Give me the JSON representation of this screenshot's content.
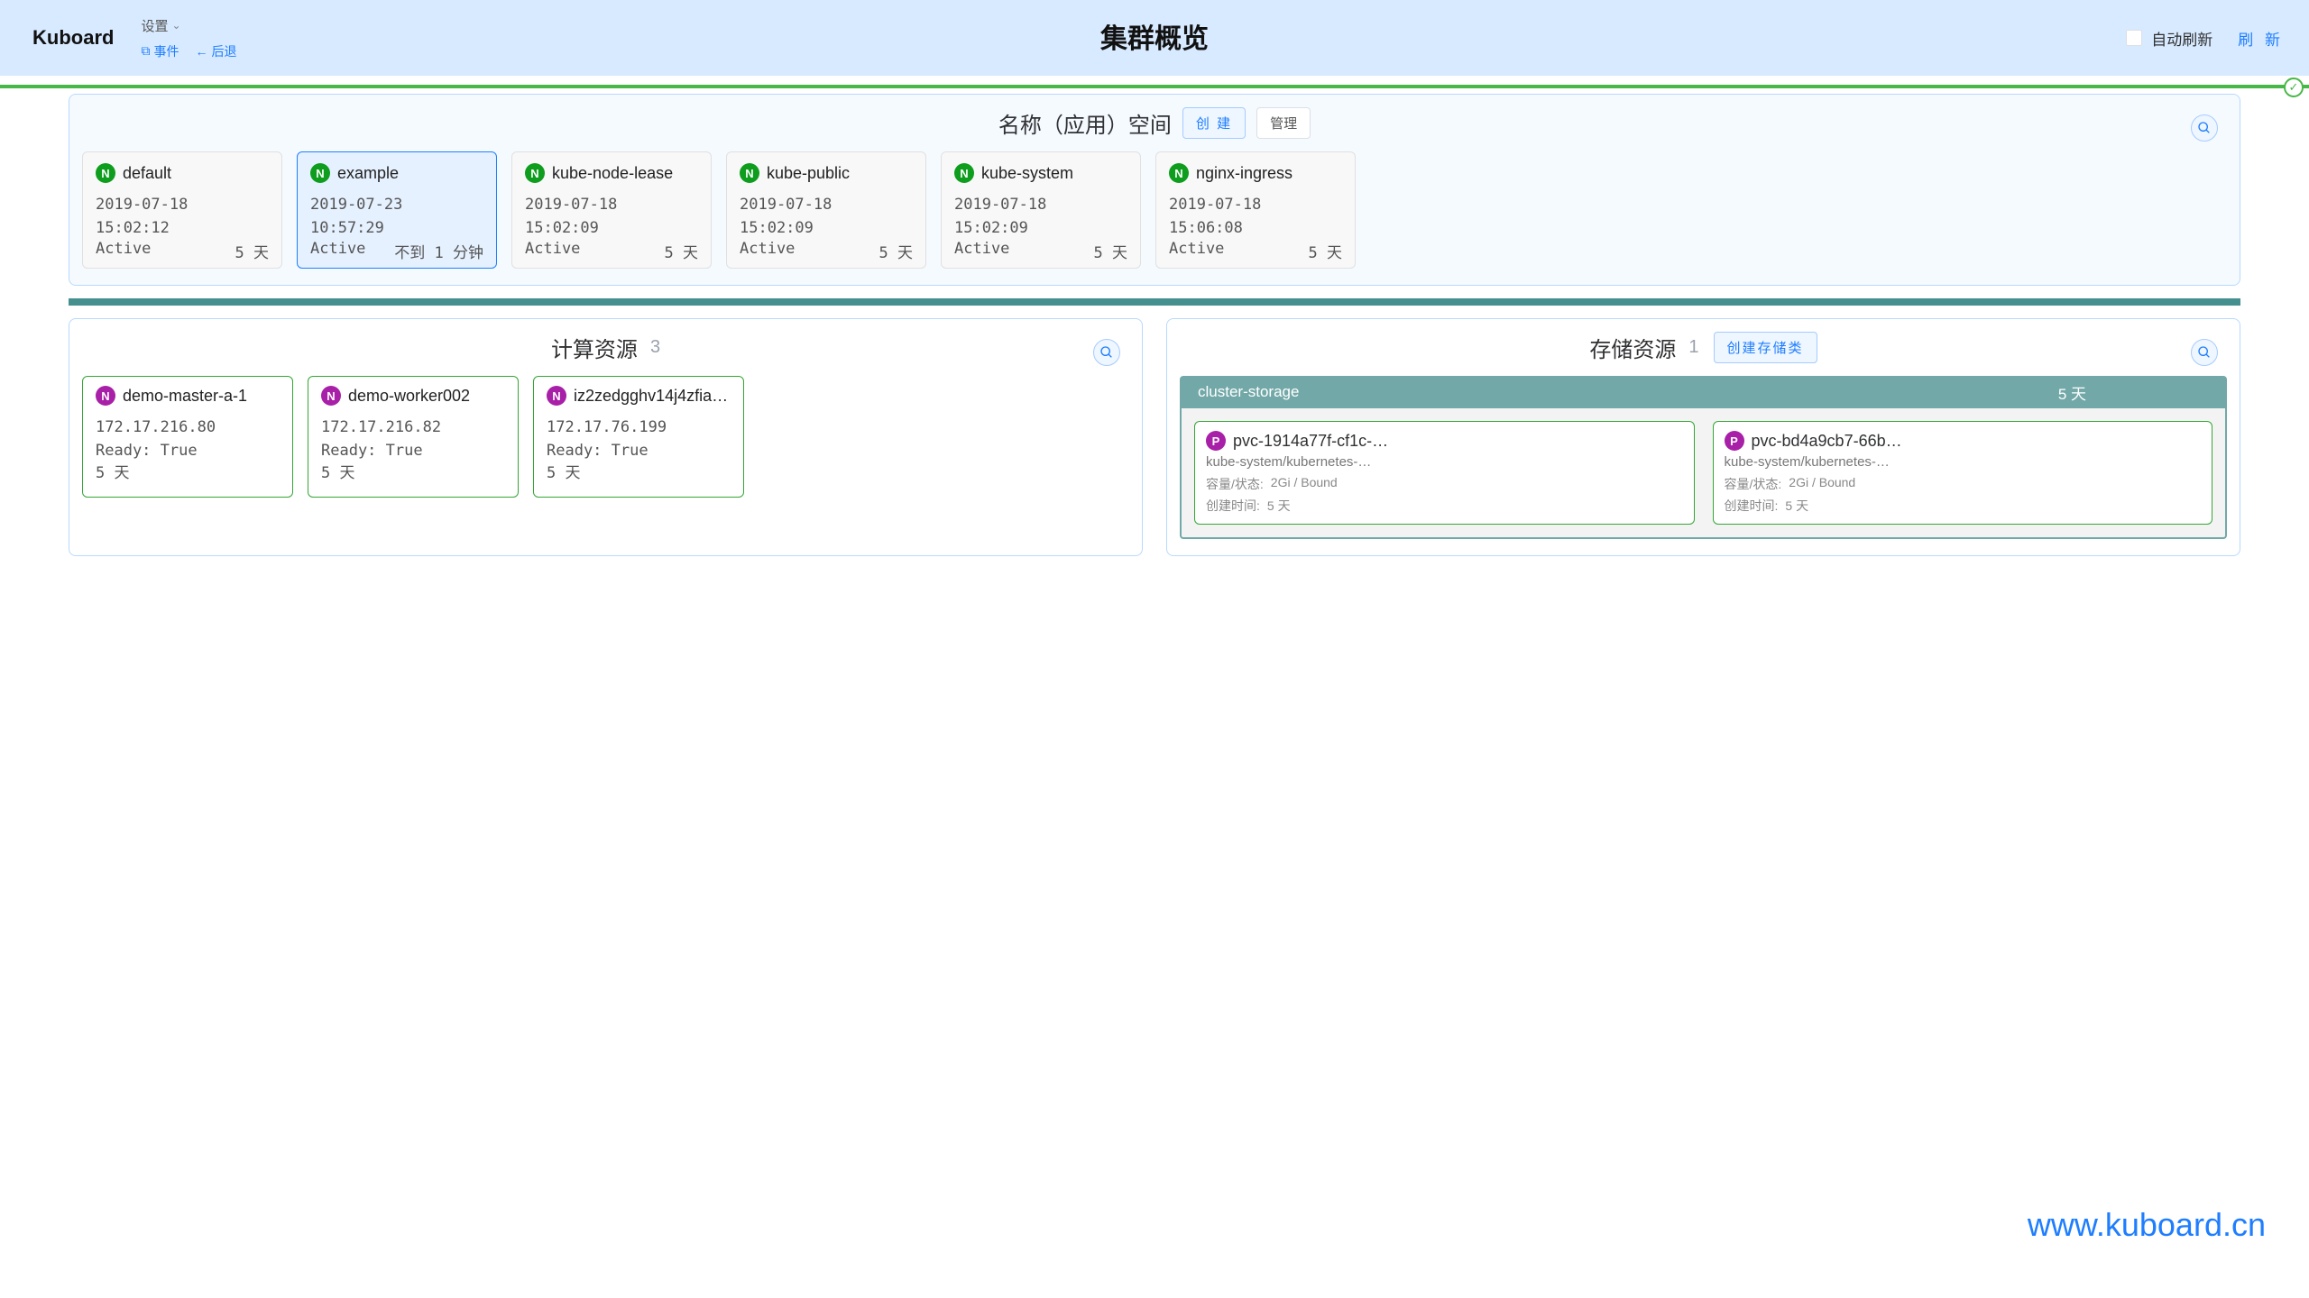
{
  "header": {
    "logo": "Kuboard",
    "settings": "设置",
    "events": "事件",
    "back": "后退",
    "title": "集群概览",
    "autoRefresh": "自动刷新",
    "refresh": "刷 新"
  },
  "ns": {
    "title": "名称（应用）空间",
    "create": "创 建",
    "manage": "管理",
    "items": [
      {
        "name": "default",
        "ts": "2019-07-18 15:02:12",
        "status": "Active",
        "age": "5 天",
        "sel": false
      },
      {
        "name": "example",
        "ts": "2019-07-23 10:57:29",
        "status": "Active",
        "age": "不到 1 分钟",
        "sel": true
      },
      {
        "name": "kube-node-lease",
        "ts": "2019-07-18 15:02:09",
        "status": "Active",
        "age": "5 天",
        "sel": false
      },
      {
        "name": "kube-public",
        "ts": "2019-07-18 15:02:09",
        "status": "Active",
        "age": "5 天",
        "sel": false
      },
      {
        "name": "kube-system",
        "ts": "2019-07-18 15:02:09",
        "status": "Active",
        "age": "5 天",
        "sel": false
      },
      {
        "name": "nginx-ingress",
        "ts": "2019-07-18 15:06:08",
        "status": "Active",
        "age": "5 天",
        "sel": false
      }
    ]
  },
  "compute": {
    "title": "计算资源",
    "count": "3",
    "nodes": [
      {
        "name": "demo-master-a-1",
        "ip": "172.17.216.80",
        "ready": "Ready: True",
        "age": "5 天"
      },
      {
        "name": "demo-worker002",
        "ip": "172.17.216.82",
        "ready": "Ready: True",
        "age": "5 天"
      },
      {
        "name": "iz2zedgghv14j4zfia…",
        "ip": "172.17.76.199",
        "ready": "Ready: True",
        "age": "5 天"
      }
    ]
  },
  "storage": {
    "title": "存储资源",
    "count": "1",
    "create": "创建存储类",
    "class": {
      "name": "cluster-storage",
      "age": "5 天"
    },
    "pvcs": [
      {
        "name": "pvc-1914a77f-cf1c-…",
        "ns": "kube-system/kubernetes-…",
        "cap": "2Gi / Bound",
        "age": "5 天"
      },
      {
        "name": "pvc-bd4a9cb7-66b…",
        "ns": "kube-system/kubernetes-…",
        "cap": "2Gi / Bound",
        "age": "5 天"
      }
    ],
    "labels": {
      "cap": "容量/状态:",
      "created": "创建时间:"
    }
  },
  "watermark": "www.kuboard.cn"
}
